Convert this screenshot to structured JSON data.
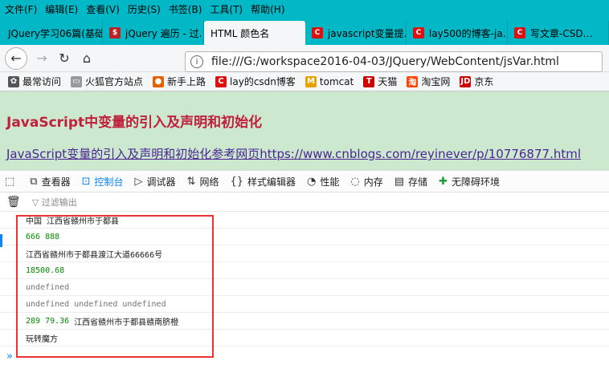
{
  "menu": [
    "文件(F)",
    "编辑(E)",
    "查看(V)",
    "历史(S)",
    "书签(B)",
    "工具(T)",
    "帮助(H)"
  ],
  "tabs": [
    {
      "label": "JQuery学习06篇(基础…",
      "icon": "none"
    },
    {
      "label": "jQuery 遍历 - 过…",
      "icon": "jquery-icon"
    },
    {
      "label": "HTML 颜色名",
      "icon": "none"
    },
    {
      "label": "javascript变量提…",
      "icon": "csdn-icon"
    },
    {
      "label": "lay500的博客-ja…",
      "icon": "csdn-icon"
    },
    {
      "label": "写文章-CSD…",
      "icon": "csdn-icon"
    }
  ],
  "url": "file:///G:/workspace2016-04-03/JQuery/WebContent/jsVar.html",
  "bookmarks": [
    {
      "label": "最常访问",
      "icon": "gear-icon"
    },
    {
      "label": "火狐官方站点",
      "icon": "folder-icon"
    },
    {
      "label": "新手上路",
      "icon": "firefox-icon"
    },
    {
      "label": "lay的csdn博客",
      "icon": "csdn-icon"
    },
    {
      "label": "tomcat",
      "icon": "tomcat-icon"
    },
    {
      "label": "天猫",
      "icon": "tmall-icon"
    },
    {
      "label": "淘宝网",
      "icon": "taobao-icon"
    },
    {
      "label": "京东",
      "icon": "jd-icon"
    }
  ],
  "page": {
    "heading": "JavaScript中变量的引入及声明和初始化",
    "link": "JavaScript变量的引入及声明和初始化参考网页https://www.cnblogs.com/reyinever/p/10776877.html"
  },
  "devtools": {
    "tabs": [
      "查看器",
      "控制台",
      "调试器",
      "网络",
      "样式编辑器",
      "性能",
      "内存",
      "存储",
      "无障碍环境"
    ],
    "active": "控制台",
    "filter_placeholder": "过滤输出"
  },
  "console_lines": [
    {
      "text": "中国 江西省赣州市于都县",
      "kind": "str"
    },
    {
      "text": "666 888",
      "kind": "num"
    },
    {
      "text": "江西省赣州市于都县渡江大道66666号",
      "kind": "str"
    },
    {
      "text": "18500.68",
      "kind": "num"
    },
    {
      "text": "undefined",
      "kind": "undef"
    },
    {
      "text": "undefined undefined undefined",
      "kind": "undef"
    },
    {
      "text": "289 79.36",
      "text2": "江西省赣州市于都县赣南脐橙",
      "kind": "mixed"
    },
    {
      "text": "玩转魔方",
      "kind": "str"
    }
  ],
  "prompt": "»"
}
